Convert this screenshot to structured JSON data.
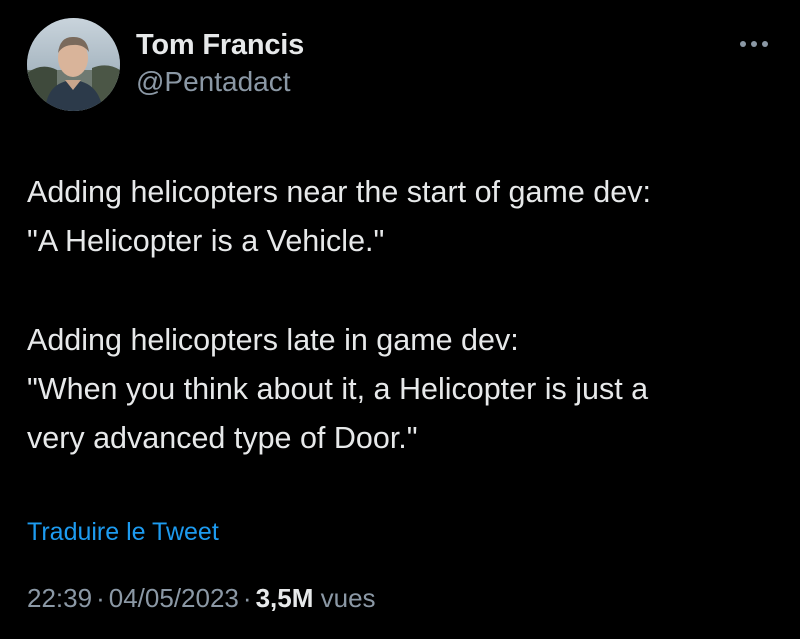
{
  "tweet": {
    "author": {
      "display_name": "Tom Francis",
      "handle": "@Pentadact",
      "avatar_icon": "profile-photo"
    },
    "more_icon": "more-horizontal-icon",
    "paragraphs": [
      "Adding helicopters near the start of game dev:\n\"A Helicopter is a Vehicle.\"",
      "Adding helicopters late in game dev:\n\"When you think about it, a Helicopter is just a\nvery advanced type of Door.\""
    ],
    "translate_label": "Traduire le Tweet",
    "meta": {
      "time": "22:39",
      "separator": "·",
      "date": "04/05/2023",
      "views_count": "3,5M",
      "views_label": "vues"
    }
  },
  "colors": {
    "background": "#000000",
    "text_primary": "#e7e9ea",
    "text_secondary": "#8b98a5",
    "link": "#1d9bf0"
  }
}
